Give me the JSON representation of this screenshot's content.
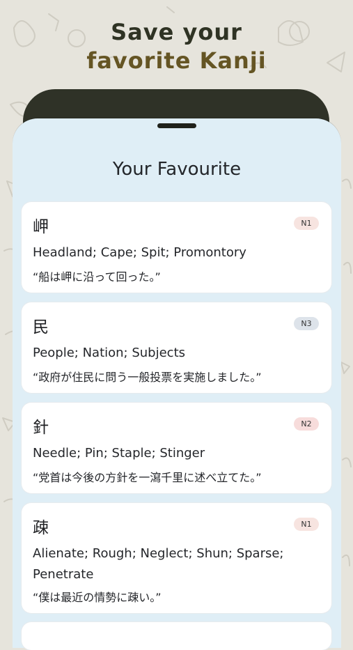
{
  "headline": {
    "line1": "Save your",
    "line2": "favorite Kanji"
  },
  "screen": {
    "title": "Your Favourite"
  },
  "cards": [
    {
      "kanji": "岬",
      "level": "N1",
      "level_color": "#f7e4e0",
      "meaning": "Headland; Cape; Spit; Promontory",
      "example": "“船は岬に沿って回った。”"
    },
    {
      "kanji": "民",
      "level": "N3",
      "level_color": "#dde3ea",
      "meaning": "People; Nation; Subjects",
      "example": "“政府が住民に問う一般投票を実施しました。”"
    },
    {
      "kanji": "針",
      "level": "N2",
      "level_color": "#f7dcdb",
      "meaning": "Needle; Pin; Staple; Stinger",
      "example": "“党首は今後の方針を一瀉千里に述べ立てた。”"
    },
    {
      "kanji": "疎",
      "level": "N1",
      "level_color": "#f7e4e0",
      "meaning": "Alienate; Rough; Neglect; Shun; Sparse; Penetrate",
      "example": "“僕は最近の情勢に疎い。”"
    }
  ],
  "colors": {
    "background": "#e6e4dc",
    "screen": "#dfeef6",
    "card": "#ffffff",
    "headline_dark": "#2f3324",
    "headline_gold": "#655524"
  }
}
